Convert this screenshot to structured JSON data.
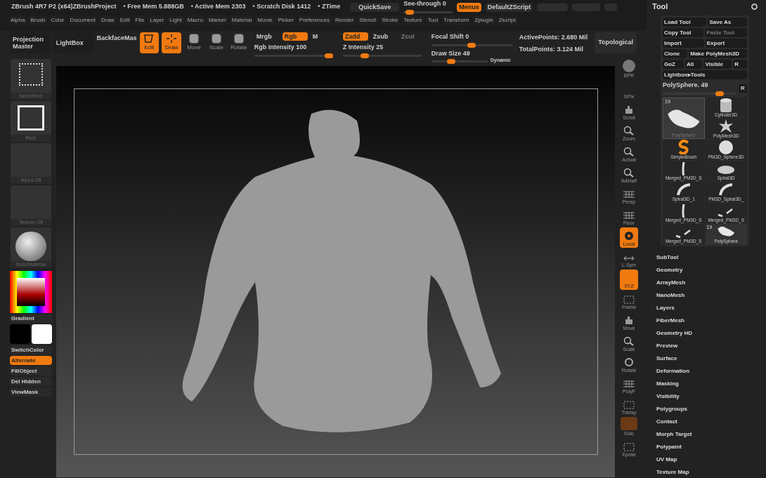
{
  "title_bar": {
    "title": "ZBrush 4R7 P2 (x64)ZBrushProject",
    "stats": [
      "• Free Mem 5.888GB",
      "• Active Mem 2303",
      "• Scratch Disk 1412",
      "• ZTime"
    ],
    "quicksave": "QuickSave",
    "see_through": {
      "label": "See-through",
      "value": "0",
      "level": 0.05
    },
    "menus": {
      "label": "Menus",
      "on": true
    },
    "script": "DefaultZScript"
  },
  "menu_bar": [
    "Alpha",
    "Brush",
    "Color",
    "Document",
    "Draw",
    "Edit",
    "File",
    "Layer",
    "Light",
    "Macro",
    "Marker",
    "Material",
    "Movie",
    "Picker",
    "Preferences",
    "Render",
    "Stencil",
    "Stroke",
    "Texture",
    "Tool",
    "Transform",
    "Zplugin",
    "Zscript"
  ],
  "toolbar": {
    "buttons": [
      "Projection Master",
      "LightBox"
    ],
    "backface": "BackfaceMas",
    "modes": [
      {
        "label": "Edit",
        "kind": "edit",
        "on": true
      },
      {
        "label": "Draw",
        "kind": "draw",
        "on": true
      },
      {
        "label": "Move",
        "kind": "move",
        "on": false
      },
      {
        "label": "Scale",
        "kind": "scale",
        "on": false
      },
      {
        "label": "Rotate",
        "kind": "rotate",
        "on": false
      }
    ],
    "color_modes": [
      {
        "label": "Mrgb",
        "on": false
      },
      {
        "label": "Rgb",
        "on": true
      },
      {
        "label": "M",
        "on": false
      }
    ],
    "rgb_intensity": {
      "label": "Rgb Intensity",
      "value": "100",
      "level": 1
    },
    "z_modes": [
      {
        "label": "Zadd",
        "on": true,
        "disabled": false
      },
      {
        "label": "Zsub",
        "on": false,
        "disabled": false
      },
      {
        "label": "Zcut",
        "on": false,
        "disabled": true
      }
    ],
    "z_intensity": {
      "label": "Z Intensity",
      "value": "25",
      "level": 0.25
    },
    "focal_shift": {
      "label": "Focal Shift",
      "value": "0",
      "level": 0.5
    },
    "draw_size": {
      "label": "Draw Size",
      "value": "49",
      "level": 0.33
    },
    "dynamic": "Dynamic",
    "points": [
      "ActivePoints: 2.680 Mil",
      "TotalPoints: 3.124 Mil"
    ],
    "topological": "Topological"
  },
  "left_shelf": {
    "thumbs": [
      {
        "label": "SelectRect",
        "kind": "selectrect"
      },
      {
        "label": "Rect",
        "kind": "rect"
      },
      {
        "label": "Alpha Off",
        "kind": "empty"
      },
      {
        "label": "Texture Off",
        "kind": "empty"
      },
      {
        "label": "BasicMaterial",
        "kind": "material"
      }
    ],
    "gradient": "Gradient",
    "buttons": [
      {
        "label": "SwitchColor",
        "on": false
      },
      {
        "label": "Alternate",
        "on": true
      },
      {
        "label": "FillObject",
        "on": false
      },
      {
        "label": "Del Hidden",
        "on": false
      },
      {
        "label": "ViewMask",
        "on": false
      }
    ]
  },
  "right_shelf": [
    {
      "label": "BPR",
      "kind": "bpr",
      "on": false
    },
    {
      "label": "SPix",
      "kind": "text",
      "on": false
    },
    {
      "label": "Scroll",
      "kind": "hand",
      "on": false
    },
    {
      "label": "Zoom",
      "kind": "zoom",
      "on": false
    },
    {
      "label": "Actual",
      "kind": "zoom",
      "on": false
    },
    {
      "label": "AAHalf",
      "kind": "zoom",
      "on": false
    },
    {
      "label": "Persp",
      "kind": "grid",
      "on": false
    },
    {
      "label": "Floor",
      "kind": "grid",
      "on": false
    },
    {
      "label": "Local",
      "kind": "local",
      "on": true
    },
    {
      "label": "L.Sym",
      "kind": "arrows",
      "on": false
    },
    {
      "label": "XYZ",
      "kind": "text",
      "on": true
    },
    {
      "label": "Frame",
      "kind": "frame",
      "on": false
    },
    {
      "label": "Move",
      "kind": "hand",
      "on": false
    },
    {
      "label": "Scale",
      "kind": "zoom",
      "on": false
    },
    {
      "label": "Rotate",
      "kind": "rotate",
      "on": false
    },
    {
      "label": "PolyF",
      "kind": "grid",
      "on": false
    },
    {
      "label": "Transp",
      "kind": "frame",
      "on": false
    },
    {
      "label": "Solo",
      "kind": "ghost",
      "on": false
    },
    {
      "label": "Xpose",
      "kind": "frame",
      "on": false
    }
  ],
  "tool_panel": {
    "title": "Tool",
    "button_rows": [
      [
        {
          "label": "Load Tool",
          "disabled": false
        },
        {
          "label": "Save As",
          "disabled": false
        }
      ],
      [
        {
          "label": "Copy Tool",
          "disabled": false
        },
        {
          "label": "Paste Tool",
          "disabled": true
        }
      ],
      [
        {
          "label": "Import",
          "disabled": false
        },
        {
          "label": "Export",
          "disabled": false
        }
      ],
      [
        {
          "label": "Clone",
          "disabled": false
        },
        {
          "label": "Make PolyMesh3D",
          "disabled": false
        }
      ],
      [
        {
          "label": "GoZ",
          "disabled": false
        },
        {
          "label": "All",
          "disabled": false
        },
        {
          "label": "Visible",
          "disabled": false
        },
        {
          "label": "R",
          "disabled": false
        }
      ],
      [
        {
          "label": "Lightbox▸Tools",
          "disabled": false
        }
      ]
    ],
    "tool_slider": {
      "label": "PolySphere. 49",
      "level": 0.82,
      "reset": "R"
    },
    "tools": [
      {
        "label": "PolySphere",
        "kind": "sculpt",
        "count": "19",
        "selected": true
      },
      {
        "label": "Cylinder3D",
        "kind": "cylinder",
        "selected": false
      },
      {
        "label": "PolyMesh3D",
        "kind": "star",
        "selected": false
      },
      {
        "label": "SimpleBrush",
        "kind": "brush",
        "selected": false
      },
      {
        "label": "PM3D_Sphere3D",
        "kind": "sphere",
        "selected": false
      },
      {
        "label": "Merged_PM3D_S",
        "kind": "strand",
        "selected": false
      },
      {
        "label": "Spiral3D",
        "kind": "disc",
        "selected": false
      },
      {
        "label": "Spiral3D_1",
        "kind": "curve",
        "selected": false
      },
      {
        "label": "PM3D_Spiral3D_",
        "kind": "curve",
        "selected": false
      },
      {
        "label": "Merged_PM3D_S",
        "kind": "strand",
        "selected": false
      },
      {
        "label": "Merged_PM3D_S",
        "kind": "bits",
        "selected": false
      },
      {
        "label": "Merged_PM3D_S",
        "kind": "bits",
        "selected": false
      },
      {
        "label": "PolySphere",
        "kind": "sculpt",
        "count": "19",
        "selected": false
      }
    ],
    "subpalettes": [
      "SubTool",
      "Geometry",
      "ArrayMesh",
      "NanoMesh",
      "Layers",
      "FiberMesh",
      "Geometry HD",
      "Preview",
      "Surface",
      "Deformation",
      "Masking",
      "Visibility",
      "Polygroups",
      "Contact",
      "Morph Target",
      "Polypaint",
      "UV Map",
      "Texture Map"
    ]
  }
}
